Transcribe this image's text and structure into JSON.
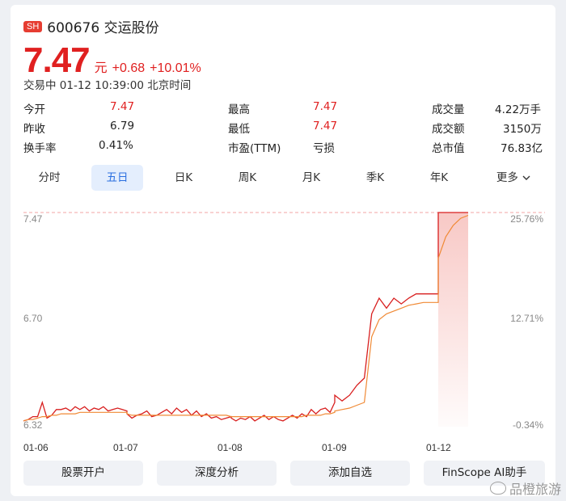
{
  "header": {
    "market": "SH",
    "code_name": "600676 交运股份"
  },
  "price": {
    "value": "7.47",
    "unit": "元",
    "change": "+0.68",
    "change_pct": "+10.01%"
  },
  "status": "交易中 01-12 10:39:00 北京时间",
  "quote": {
    "rows": [
      [
        {
          "label": "今开",
          "value": "7.47",
          "red": true
        },
        {
          "label": "最高",
          "value": "7.47",
          "red": true
        },
        {
          "label": "成交量",
          "value": "4.22万手",
          "red": false
        }
      ],
      [
        {
          "label": "昨收",
          "value": "6.79",
          "red": false
        },
        {
          "label": "最低",
          "value": "7.47",
          "red": true
        },
        {
          "label": "成交额",
          "value": "3150万",
          "red": false
        }
      ],
      [
        {
          "label": "换手率",
          "value": "0.41%",
          "red": false
        },
        {
          "label": "市盈(TTM)",
          "value": "亏损",
          "red": false
        },
        {
          "label": "总市值",
          "value": "76.83亿",
          "red": false
        }
      ]
    ]
  },
  "tabs": [
    "分时",
    "五日",
    "日K",
    "周K",
    "月K",
    "季K",
    "年K",
    "更多"
  ],
  "active_tab": 1,
  "chart_data": {
    "type": "line",
    "y_left": [
      "7.47",
      "6.70",
      "6.32"
    ],
    "y_right": [
      "25.76%",
      "12.71%",
      "-0.34%"
    ],
    "x_labels": [
      "01-06",
      "01-07",
      "01-08",
      "01-09",
      "01-12"
    ],
    "ylim": [
      5.97,
      7.47
    ],
    "series": [
      {
        "color": "#d81e1e",
        "values": [
          6.01,
          6.02,
          6.04,
          6.04,
          6.14,
          6.03,
          6.05,
          6.09,
          6.09,
          6.1,
          6.08,
          6.11,
          6.09,
          6.11,
          6.08,
          6.1,
          6.09,
          6.11,
          6.08,
          6.09,
          6.1,
          6.09,
          6.08,
          6.06,
          6.03,
          6.05,
          6.06,
          6.08,
          6.04,
          6.05,
          6.07,
          6.09,
          6.06,
          6.1,
          6.07,
          6.09,
          6.05,
          6.08,
          6.04,
          6.06,
          6.03,
          6.04,
          6.02,
          6.03,
          6.04,
          6.03,
          6.01,
          6.03,
          6.02,
          6.04,
          6.01,
          6.03,
          6.05,
          6.02,
          6.04,
          6.02,
          6.01,
          6.03,
          6.05,
          6.03,
          6.06,
          6.04,
          6.09,
          6.06,
          6.09,
          6.1,
          6.07,
          6.14,
          6.19,
          6.15,
          6.19,
          6.26,
          6.31,
          6.76,
          6.87,
          6.8,
          6.87,
          6.83,
          6.87,
          6.9,
          6.9,
          6.9,
          6.9,
          7.47,
          7.47,
          7.47,
          7.47,
          7.47
        ]
      },
      {
        "color": "#f08a36",
        "values": [
          6.01,
          6.02,
          6.02,
          6.03,
          6.04,
          6.04,
          6.05,
          6.05,
          6.06,
          6.06,
          6.06,
          6.06,
          6.07,
          6.07,
          6.07,
          6.07,
          6.07,
          6.07,
          6.07,
          6.07,
          6.07,
          6.07,
          6.07,
          6.06,
          6.05,
          6.05,
          6.05,
          6.05,
          6.05,
          6.05,
          6.05,
          6.05,
          6.05,
          6.05,
          6.05,
          6.05,
          6.05,
          6.05,
          6.05,
          6.05,
          6.05,
          6.05,
          6.05,
          6.05,
          6.04,
          6.04,
          6.04,
          6.04,
          6.04,
          6.04,
          6.04,
          6.04,
          6.04,
          6.04,
          6.04,
          6.04,
          6.04,
          6.04,
          6.04,
          6.04,
          6.04,
          6.05,
          6.05,
          6.05,
          6.05,
          6.06,
          6.06,
          6.07,
          6.08,
          6.09,
          6.1,
          6.12,
          6.14,
          6.6,
          6.72,
          6.76,
          6.78,
          6.8,
          6.82,
          6.83,
          6.84,
          6.84,
          6.84,
          7.15,
          7.3,
          7.38,
          7.43,
          7.45
        ]
      }
    ]
  },
  "buttons": [
    "股票开户",
    "深度分析",
    "添加自选",
    "FinScope AI助手"
  ],
  "watermark": "品橙旅游"
}
